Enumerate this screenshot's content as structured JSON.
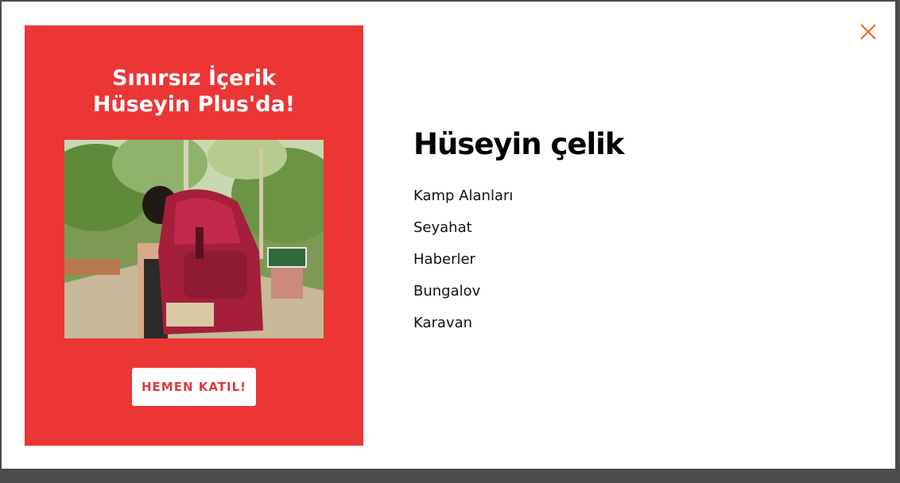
{
  "promo": {
    "title_line1": "Sınırsız İçerik",
    "title_line2": "Hüseyin Plus'da!",
    "join_button": "HEMEN KATIL!"
  },
  "menu": {
    "title": "Hüseyin çelik",
    "items": [
      {
        "label": "Kamp Alanları"
      },
      {
        "label": "Seyahat"
      },
      {
        "label": "Haberler"
      },
      {
        "label": "Bungalov"
      },
      {
        "label": "Karavan"
      }
    ]
  },
  "icons": {
    "close": "close-icon"
  },
  "colors": {
    "promo_background": "#ec3535",
    "close_icon": "#e8731f",
    "backdrop": "#4b4b4b"
  }
}
